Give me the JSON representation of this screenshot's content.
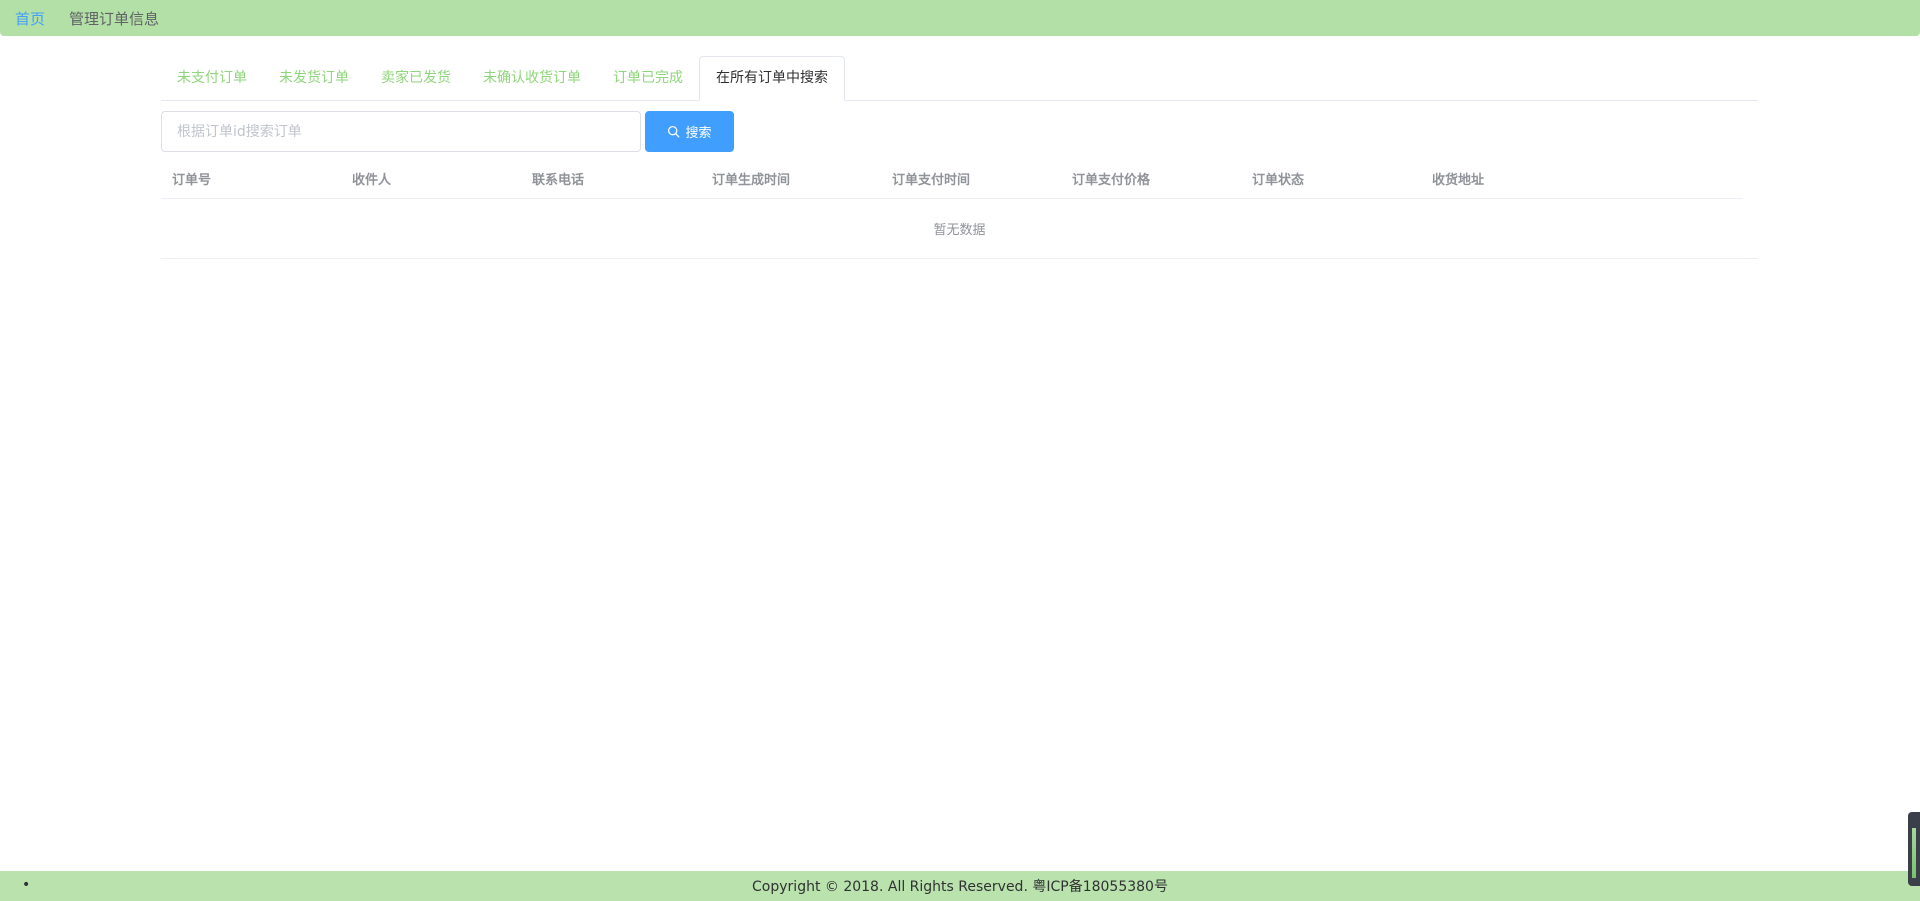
{
  "breadcrumb": {
    "home": "首页",
    "current": "管理订单信息"
  },
  "tabs": [
    {
      "label": "未支付订单"
    },
    {
      "label": "未发货订单"
    },
    {
      "label": "卖家已发货"
    },
    {
      "label": "未确认收货订单"
    },
    {
      "label": "订单已完成"
    },
    {
      "label": "在所有订单中搜索"
    }
  ],
  "active_tab": 5,
  "search": {
    "placeholder": "根据订单id搜索订单",
    "value": "",
    "button_label": "搜索"
  },
  "table": {
    "columns": [
      "订单号",
      "收件人",
      "联系电话",
      "订单生成时间",
      "订单支付时间",
      "订单支付价格",
      "订单状态",
      "收货地址"
    ],
    "rows": [],
    "empty_text": "暂无数据"
  },
  "footer": {
    "bullet": "•",
    "copyright": "Copyright © 2018. All Rights Reserved. 粤ICP备18055380号"
  },
  "colors": {
    "topbar": "#b3e0a6",
    "footer": "#b9e2ad",
    "tab_inactive": "#8fd67a",
    "primary": "#409eff"
  }
}
